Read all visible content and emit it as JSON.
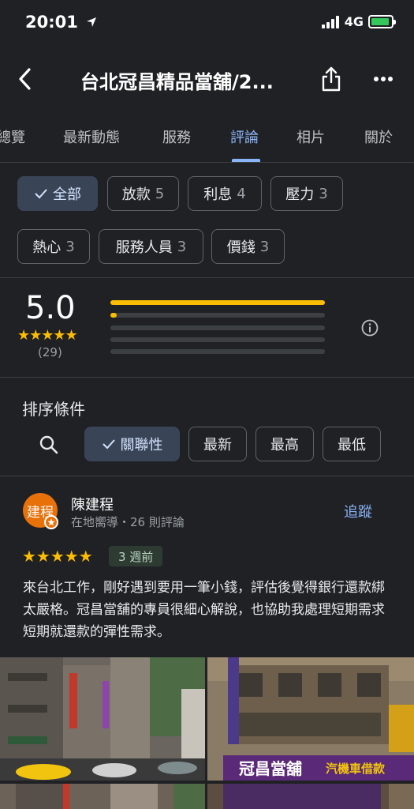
{
  "status_bar": {
    "time": "20:01",
    "network": "4G"
  },
  "header": {
    "title": "台北冠昌精品當舖/2..."
  },
  "tabs": [
    {
      "label": "總覽",
      "active": false
    },
    {
      "label": "最新動態",
      "active": false
    },
    {
      "label": "服務",
      "active": false
    },
    {
      "label": "評論",
      "active": true
    },
    {
      "label": "相片",
      "active": false
    },
    {
      "label": "關於",
      "active": false
    }
  ],
  "filters": [
    {
      "label": "全部",
      "count": "",
      "selected": true
    },
    {
      "label": "放款",
      "count": "5",
      "selected": false
    },
    {
      "label": "利息",
      "count": "4",
      "selected": false
    },
    {
      "label": "壓力",
      "count": "3",
      "selected": false
    },
    {
      "label": "熱心",
      "count": "3",
      "selected": false
    },
    {
      "label": "服務人員",
      "count": "3",
      "selected": false
    },
    {
      "label": "價錢",
      "count": "3",
      "selected": false
    }
  ],
  "summary": {
    "score": "5.0",
    "stars": "★★★★★",
    "count": "(29)",
    "distribution": [
      {
        "stars": 5,
        "fraction": 1.0
      },
      {
        "stars": 4,
        "fraction": 0.03
      },
      {
        "stars": 3,
        "fraction": 0
      },
      {
        "stars": 2,
        "fraction": 0
      },
      {
        "stars": 1,
        "fraction": 0
      }
    ]
  },
  "sort": {
    "title": "排序條件",
    "options": [
      {
        "label": "關聯性",
        "selected": true
      },
      {
        "label": "最新",
        "selected": false
      },
      {
        "label": "最高",
        "selected": false
      },
      {
        "label": "最低",
        "selected": false
      }
    ]
  },
  "review": {
    "avatar_text": "建程",
    "name": "陳建程",
    "meta": "在地嚮導・26 則評論",
    "follow_label": "追蹤",
    "stars": "★★★★★",
    "time": "3 週前",
    "text": "來台北工作，剛好遇到要用一筆小錢，評估後覺得銀行還款綁太嚴格。冠昌當舖的專員很細心解說，也協助我處理短期需求短期就還款的彈性需求。",
    "photo_sign_1": "冠昌當舖",
    "photo_sign_2": "汽機車借款"
  },
  "colors": {
    "background": "#202124",
    "accent": "#8ab4f8",
    "star": "#fbbc04",
    "avatar": "#e8710a"
  }
}
